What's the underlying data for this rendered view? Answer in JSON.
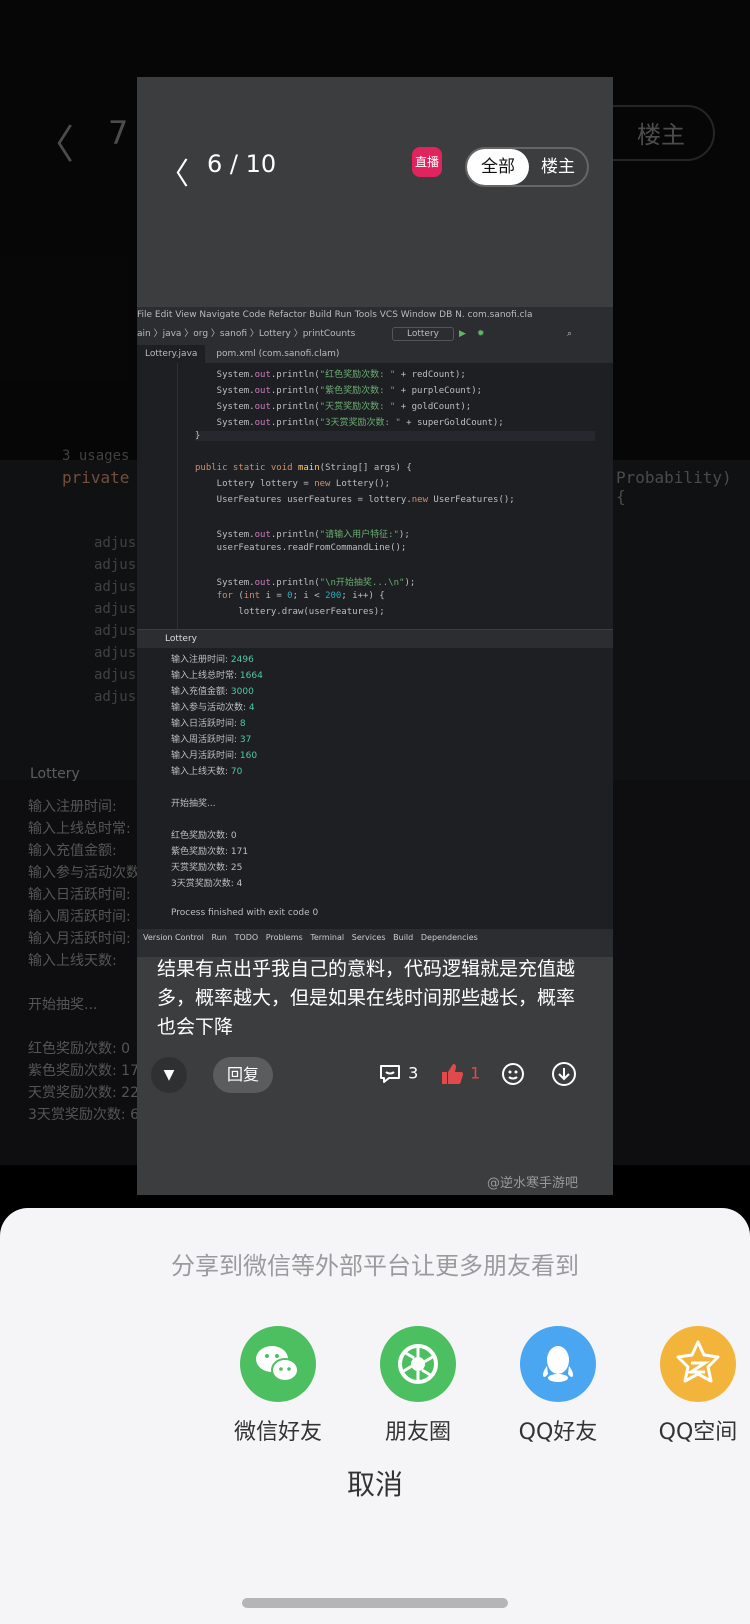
{
  "background": {
    "page_number": "7",
    "op_label": "楼主",
    "usages": "3 usages",
    "code_word": "private",
    "code_right": "Probability) {",
    "console_title": "Lottery",
    "console_lines": [
      "输入注册时间:",
      "输入上线总时常:",
      "输入充值金额:",
      "输入参与活动次数:",
      "输入日活跃时间:",
      "输入周活跃时间:",
      "输入月活跃时间:",
      "输入上线天数:",
      "开始抽奖...",
      "红色奖励次数: 0",
      "紫色奖励次数: 17",
      "天赏奖励次数: 22",
      "3天赏奖励次数: 6"
    ]
  },
  "viewer": {
    "counter": "6 / 10",
    "live_label": "直播",
    "tab_all": "全部",
    "tab_op": "楼主",
    "caption": "结果有点出乎我自己的意料，代码逻辑就是充值越多，概率越大，但是如果在线时间那些越长，概率也会下降",
    "reply_label": "回复",
    "comment_count": "3",
    "like_count": "1",
    "watermark": "@逆水寒手游吧"
  },
  "ide": {
    "menu": "File  Edit  View  Navigate  Code  Refactor  Build  Run  Tools  VCS  Window  DB N.  com.sanofi.cla",
    "path": "ain 〉java 〉org 〉sanofi 〉Lottery 〉printCounts",
    "run_config": "Lottery",
    "tab1": "Lottery.java",
    "tab2": "pom.xml (com.sanofi.clam)",
    "run_tab": "Lottery",
    "status_items": [
      "Version Control",
      "Run",
      "TODO",
      "Problems",
      "Terminal",
      "Services",
      "Build",
      "Dependencies"
    ],
    "output": [
      {
        "k": "输入注册时间: ",
        "v": "2496"
      },
      {
        "k": "输入上线总时常: ",
        "v": "1664"
      },
      {
        "k": "输入充值金额: ",
        "v": "3000"
      },
      {
        "k": "输入参与活动次数: ",
        "v": "4"
      },
      {
        "k": "输入日活跃时间: ",
        "v": "8"
      },
      {
        "k": "输入周活跃时间: ",
        "v": "37"
      },
      {
        "k": "输入月活跃时间: ",
        "v": "160"
      },
      {
        "k": "输入上线天数: ",
        "v": "70"
      }
    ],
    "start_text": "开始抽奖...",
    "results": [
      "红色奖励次数: 0",
      "紫色奖励次数: 171",
      "天赏奖励次数: 25",
      "3天赏奖励次数: 4"
    ],
    "finish_text": "Process finished with exit code 0"
  },
  "share": {
    "title": "分享到微信等外部平台让更多朋友看到",
    "items": [
      {
        "label": "微信好友",
        "color": "#4cc061"
      },
      {
        "label": "朋友圈",
        "color": "#4cc061"
      },
      {
        "label": "QQ好友",
        "color": "#4ba6f2"
      },
      {
        "label": "QQ空间",
        "color": "#f3b43b"
      }
    ],
    "cancel": "取消"
  }
}
